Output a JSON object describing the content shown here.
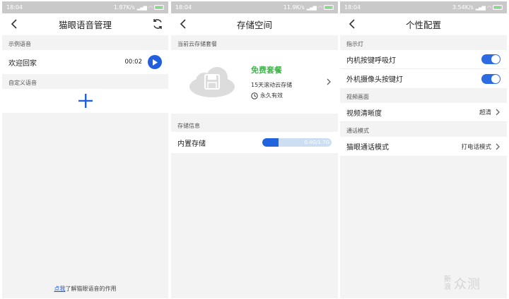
{
  "screens": [
    {
      "status": {
        "time": "18:04",
        "speed": "1.87K/s"
      },
      "title": "猫眼语音管理",
      "sample_label": "示例语音",
      "sample_item": {
        "name": "欢迎回家",
        "duration": "00:02"
      },
      "custom_label": "自定义语音",
      "footer": {
        "link": "点我",
        "text": "了解猫眼语音的作用"
      }
    },
    {
      "status": {
        "time": "18:04",
        "speed": "11.9K/s"
      },
      "title": "存储空间",
      "plan_label": "当前云存储套餐",
      "plan": {
        "name": "免费套餐",
        "desc": "15天滚动云存储",
        "validity": "永久有效"
      },
      "storage_label": "存储信息",
      "storage": {
        "label": "内置存储",
        "usage": "0.4G/1.7G",
        "fraction": 0.235
      }
    },
    {
      "status": {
        "time": "18:04",
        "speed": "3.54K/s"
      },
      "title": "个性配置",
      "indicator_label": "指示灯",
      "toggles": [
        {
          "label": "内机按键呼吸灯",
          "on": true
        },
        {
          "label": "外机摄像头按键灯",
          "on": true
        }
      ],
      "video_label": "视频画面",
      "video_quality": {
        "label": "视频清晰度",
        "value": "超清"
      },
      "call_label": "通话模式",
      "call_mode": {
        "label": "猫眼通话模式",
        "value": "打电话模式"
      }
    }
  ],
  "watermark": {
    "chars": [
      "新",
      "浪"
    ],
    "text": "众测"
  },
  "colors": {
    "accent": "#1f5fe0",
    "green": "#3fb84a",
    "statusbar": "#c9c9c9",
    "bg": "#f3f3f3"
  }
}
